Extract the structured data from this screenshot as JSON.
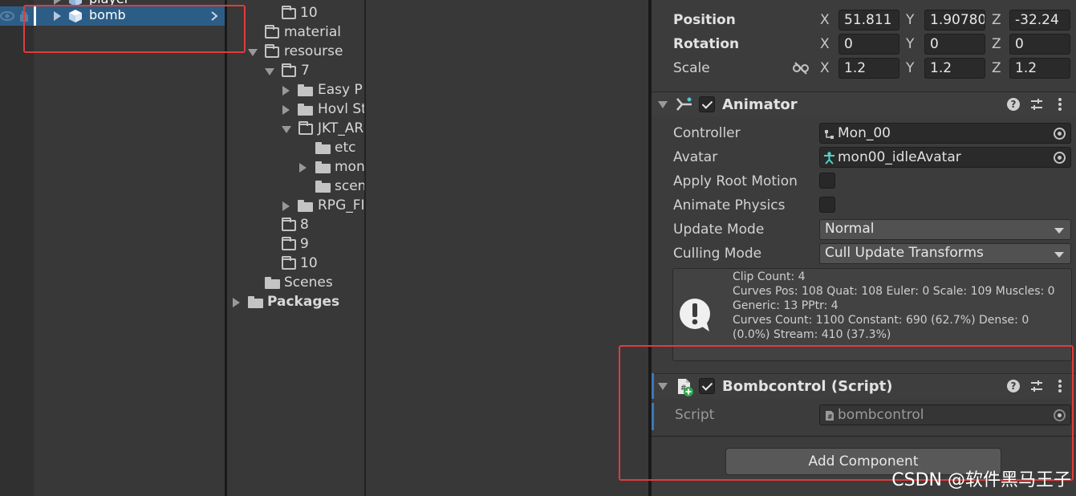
{
  "hierarchy": {
    "items": [
      {
        "label": "player"
      },
      {
        "label": "bomb"
      }
    ]
  },
  "project": {
    "items": [
      {
        "label": "10"
      },
      {
        "label": "material"
      },
      {
        "label": "resourse"
      },
      {
        "label": "7"
      },
      {
        "label": "Easy P"
      },
      {
        "label": "Hovl St"
      },
      {
        "label": "JKT_AR"
      },
      {
        "label": "etc"
      },
      {
        "label": "mon"
      },
      {
        "label": "scen"
      },
      {
        "label": "RPG_FI"
      },
      {
        "label": "8"
      },
      {
        "label": "9"
      },
      {
        "label": "10"
      },
      {
        "label": "Scenes"
      },
      {
        "label": "Packages"
      }
    ]
  },
  "inspector": {
    "transform": {
      "position": {
        "label": "Position",
        "x": "51.811",
        "y": "1.90780",
        "z": "-32.24"
      },
      "rotation": {
        "label": "Rotation",
        "x": "0",
        "y": "0",
        "z": "0"
      },
      "scale": {
        "label": "Scale",
        "x": "1.2",
        "y": "1.2",
        "z": "1.2"
      },
      "axes": {
        "x": "X",
        "y": "Y",
        "z": "Z"
      }
    },
    "animator": {
      "title": "Animator",
      "controller_label": "Controller",
      "controller_value": "Mon_00",
      "avatar_label": "Avatar",
      "avatar_value": "mon00_idleAvatar",
      "apply_root_motion_label": "Apply Root Motion",
      "animate_physics_label": "Animate Physics",
      "update_mode_label": "Update Mode",
      "update_mode_value": "Normal",
      "culling_mode_label": "Culling Mode",
      "culling_mode_value": "Cull Update Transforms",
      "info_lines": [
        "Clip Count: 4",
        "Curves Pos: 108 Quat: 108 Euler: 0 Scale: 109 Muscles: 0",
        "Generic: 13 PPtr: 4",
        "Curves Count: 1100 Constant: 690 (62.7%) Dense: 0",
        "(0.0%) Stream: 410 (37.3%)"
      ]
    },
    "bombcontrol": {
      "title": "Bombcontrol (Script)",
      "script_label": "Script",
      "script_value": "bombcontrol"
    },
    "add_component_label": "Add Component"
  },
  "watermark": "CSDN @软件黑马王子",
  "colors": {
    "selection": "#2c5d87",
    "highlight_box": "#e03c3c",
    "accent_bar": "#3a79bb"
  },
  "icons": {
    "hierarchy": [
      "visibility-eye-icon",
      "pickable-hand-icon",
      "gameobject-cube-icon",
      "chevron-right-icon"
    ],
    "project": [
      "folder-icon",
      "empty-folder-icon",
      "foldout-arrow-icon"
    ],
    "inspector": [
      "constrain-proportions-icon",
      "animator-icon",
      "script-icon",
      "help-icon",
      "presets-icon",
      "kebab-menu-icon",
      "object-picker-icon",
      "info-icon",
      "dropdown-arrow-icon"
    ]
  }
}
